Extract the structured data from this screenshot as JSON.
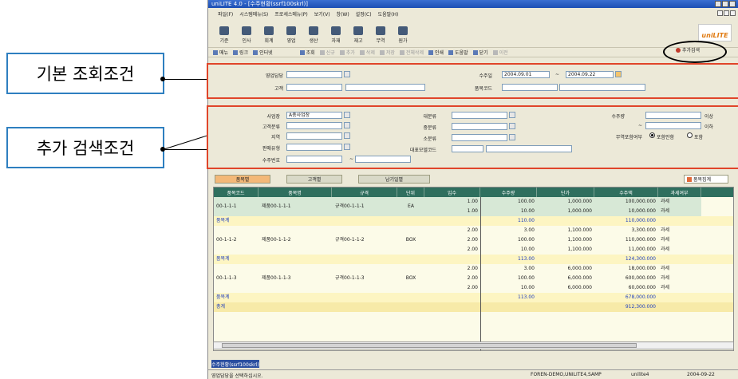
{
  "callouts": {
    "basic": "기본 조회조건",
    "additional": "추가 검색조건"
  },
  "window": {
    "title": "uniLITE 4.0 - [수주현황(ssrf100skrl)]",
    "menu": [
      "파일(F)",
      "시스템메뉴(S)",
      "프로세스메뉴(P)",
      "보기(V)",
      "창(W)",
      "설정(C)",
      "도움말(H)"
    ],
    "logo": "uniLITE"
  },
  "big_toolbar": [
    "기준",
    "인사",
    "회계",
    "영업",
    "생산",
    "자재",
    "재고",
    "무역",
    "원가"
  ],
  "small_toolbar": {
    "menu": "메뉴",
    "link": "링크",
    "internet": "인터넷",
    "query": "조회",
    "new": "신규",
    "add": "추가",
    "delete": "삭제",
    "save": "저장",
    "delete_all": "전체삭제",
    "print": "인쇄",
    "help": "도움말",
    "close": "닫기",
    "prev": "이전",
    "additional_search": "추가검색"
  },
  "basic_search": {
    "sales_rep_label": "영업담당",
    "customer_label": "고객",
    "order_date_label": "수주일",
    "order_date_from": "2004.09.01",
    "order_date_to": "2004.09.22",
    "order_no_label": "품목코드"
  },
  "additional_search": {
    "business_label": "사업장",
    "business_value": "A총사업장",
    "customer_class_label": "고객분류",
    "region_label": "지역",
    "sales_type_label": "판매유형",
    "order_no_label": "수주번호",
    "major_label": "대분류",
    "middle_label": "중분류",
    "minor_label": "소분류",
    "rep_model_label": "대표모델코드",
    "qty_label": "수주량",
    "qty_min_suffix": "이상",
    "qty_tilde": "~",
    "qty_max_suffix": "이하",
    "trade_label": "무역포함여부",
    "trade_opt1": "포함안함",
    "trade_opt2": "포함"
  },
  "tabs": [
    "품목별",
    "고객별",
    "납기일별"
  ],
  "group_button": "품목집계",
  "grid": {
    "columns": [
      "품목코드",
      "품목명",
      "규격",
      "단위",
      "입수",
      "수주량",
      "단가",
      "수주액",
      "과세여부"
    ],
    "groups": [
      {
        "code": "00-1-1-1",
        "name": "제품00-1-1-1",
        "spec": "규격00-1-1-1",
        "unit": "EA",
        "rows": [
          {
            "pack": "1.00",
            "qty": "100.00",
            "price": "1,000.000",
            "amount": "100,000.000",
            "tax": "과세"
          },
          {
            "pack": "1.00",
            "qty": "10.00",
            "price": "1,000.000",
            "amount": "10,000.000",
            "tax": "과세"
          }
        ],
        "subtotal_label": "품목계",
        "subtotal_qty": "110.00",
        "subtotal_amount": "110,000.000"
      },
      {
        "code": "00-1-1-2",
        "name": "제품00-1-1-2",
        "spec": "규격00-1-1-2",
        "unit": "BOX",
        "rows": [
          {
            "pack": "2.00",
            "qty": "3.00",
            "price": "1,100.000",
            "amount": "3,300.000",
            "tax": "과세"
          },
          {
            "pack": "2.00",
            "qty": "100.00",
            "price": "1,100.000",
            "amount": "110,000.000",
            "tax": "과세"
          },
          {
            "pack": "2.00",
            "qty": "10.00",
            "price": "1,100.000",
            "amount": "11,000.000",
            "tax": "과세"
          }
        ],
        "subtotal_label": "품목계",
        "subtotal_qty": "113.00",
        "subtotal_amount": "124,300.000"
      },
      {
        "code": "00-1-1-3",
        "name": "제품00-1-1-3",
        "spec": "규격00-1-1-3",
        "unit": "BOX",
        "rows": [
          {
            "pack": "2.00",
            "qty": "3.00",
            "price": "6,000.000",
            "amount": "18,000.000",
            "tax": "과세"
          },
          {
            "pack": "2.00",
            "qty": "100.00",
            "price": "6,000.000",
            "amount": "600,000.000",
            "tax": "과세"
          },
          {
            "pack": "2.00",
            "qty": "10.00",
            "price": "6,000.000",
            "amount": "60,000.000",
            "tax": "과세"
          }
        ],
        "subtotal_label": "품목계",
        "subtotal_qty": "113.00",
        "subtotal_amount": "678,000.000"
      }
    ],
    "total_label": "총계",
    "total_amount": "912,300.000"
  },
  "taskbar": {
    "tab": "수주현황(ssrf100skrl)"
  },
  "status": {
    "message": "영업담당을 선택하십시오.",
    "server": "FOREN-DEMO,UNILITE4,SAMP",
    "user": "unilite4",
    "date": "2004-09-22"
  }
}
